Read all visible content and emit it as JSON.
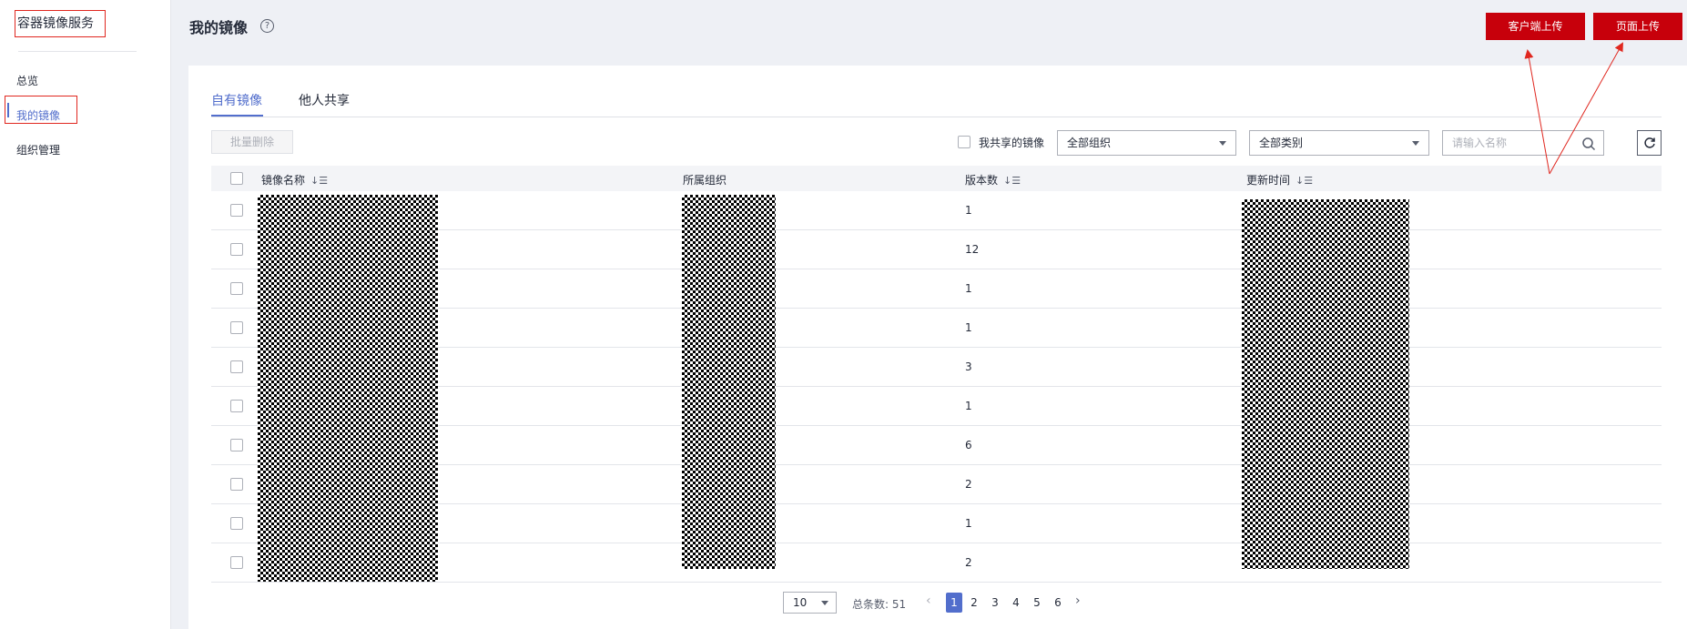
{
  "sidebar": {
    "title": "容器镜像服务",
    "items": [
      {
        "label": "总览"
      },
      {
        "label": "我的镜像"
      },
      {
        "label": "组织管理"
      }
    ]
  },
  "header": {
    "title": "我的镜像",
    "help_icon": "?",
    "client_upload": "客户端上传",
    "page_upload": "页面上传"
  },
  "tabs": [
    {
      "label": "自有镜像"
    },
    {
      "label": "他人共享"
    }
  ],
  "toolbar": {
    "batch_delete": "批量删除",
    "shared_checkbox_label": "我共享的镜像",
    "org_select": "全部组织",
    "category_select": "全部类别",
    "search_placeholder": "请输入名称"
  },
  "table": {
    "columns": [
      "镜像名称",
      "所属组织",
      "版本数",
      "更新时间"
    ],
    "rows": [
      {
        "versions": "1"
      },
      {
        "versions": "12"
      },
      {
        "versions": "1"
      },
      {
        "versions": "1"
      },
      {
        "versions": "3"
      },
      {
        "versions": "1"
      },
      {
        "versions": "6"
      },
      {
        "versions": "2"
      },
      {
        "versions": "1"
      },
      {
        "versions": "2"
      }
    ]
  },
  "pagination": {
    "page_size": "10",
    "total_label": "总条数: 51",
    "pages": [
      "1",
      "2",
      "3",
      "4",
      "5",
      "6"
    ],
    "current": "1"
  },
  "colors": {
    "accent": "#526ecc",
    "brand_red": "#c7000b",
    "annotation_red": "#e0271f"
  }
}
